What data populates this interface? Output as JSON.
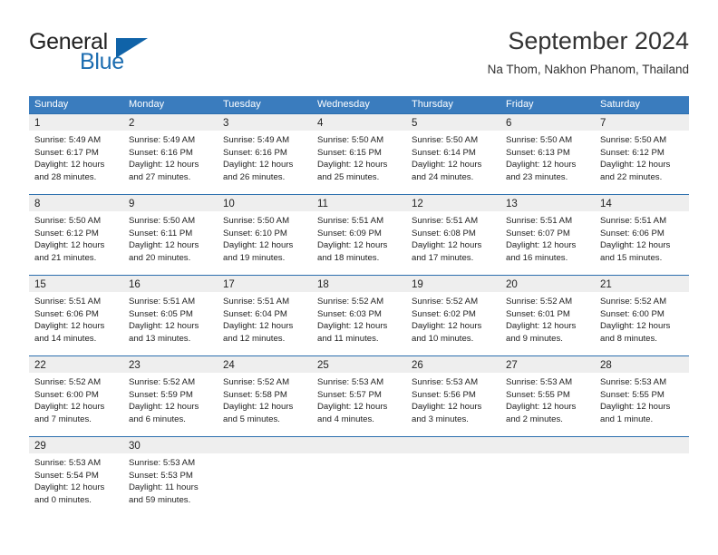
{
  "brand": {
    "name_part1": "General",
    "name_part2": "Blue",
    "triangle_color": "#1063a8",
    "blue_text_color": "#1b6cb0"
  },
  "header": {
    "title": "September 2024",
    "subtitle": "Na Thom, Nakhon Phanom, Thailand"
  },
  "theme": {
    "header_blue": "#3a7cbe",
    "row_border_blue": "#2c6fae",
    "day_band_gray": "#eeeeee"
  },
  "weekdays": [
    "Sunday",
    "Monday",
    "Tuesday",
    "Wednesday",
    "Thursday",
    "Friday",
    "Saturday"
  ],
  "weeks": [
    [
      {
        "day": "1",
        "sunrise": "Sunrise: 5:49 AM",
        "sunset": "Sunset: 6:17 PM",
        "daylight1": "Daylight: 12 hours",
        "daylight2": "and 28 minutes."
      },
      {
        "day": "2",
        "sunrise": "Sunrise: 5:49 AM",
        "sunset": "Sunset: 6:16 PM",
        "daylight1": "Daylight: 12 hours",
        "daylight2": "and 27 minutes."
      },
      {
        "day": "3",
        "sunrise": "Sunrise: 5:49 AM",
        "sunset": "Sunset: 6:16 PM",
        "daylight1": "Daylight: 12 hours",
        "daylight2": "and 26 minutes."
      },
      {
        "day": "4",
        "sunrise": "Sunrise: 5:50 AM",
        "sunset": "Sunset: 6:15 PM",
        "daylight1": "Daylight: 12 hours",
        "daylight2": "and 25 minutes."
      },
      {
        "day": "5",
        "sunrise": "Sunrise: 5:50 AM",
        "sunset": "Sunset: 6:14 PM",
        "daylight1": "Daylight: 12 hours",
        "daylight2": "and 24 minutes."
      },
      {
        "day": "6",
        "sunrise": "Sunrise: 5:50 AM",
        "sunset": "Sunset: 6:13 PM",
        "daylight1": "Daylight: 12 hours",
        "daylight2": "and 23 minutes."
      },
      {
        "day": "7",
        "sunrise": "Sunrise: 5:50 AM",
        "sunset": "Sunset: 6:12 PM",
        "daylight1": "Daylight: 12 hours",
        "daylight2": "and 22 minutes."
      }
    ],
    [
      {
        "day": "8",
        "sunrise": "Sunrise: 5:50 AM",
        "sunset": "Sunset: 6:12 PM",
        "daylight1": "Daylight: 12 hours",
        "daylight2": "and 21 minutes."
      },
      {
        "day": "9",
        "sunrise": "Sunrise: 5:50 AM",
        "sunset": "Sunset: 6:11 PM",
        "daylight1": "Daylight: 12 hours",
        "daylight2": "and 20 minutes."
      },
      {
        "day": "10",
        "sunrise": "Sunrise: 5:50 AM",
        "sunset": "Sunset: 6:10 PM",
        "daylight1": "Daylight: 12 hours",
        "daylight2": "and 19 minutes."
      },
      {
        "day": "11",
        "sunrise": "Sunrise: 5:51 AM",
        "sunset": "Sunset: 6:09 PM",
        "daylight1": "Daylight: 12 hours",
        "daylight2": "and 18 minutes."
      },
      {
        "day": "12",
        "sunrise": "Sunrise: 5:51 AM",
        "sunset": "Sunset: 6:08 PM",
        "daylight1": "Daylight: 12 hours",
        "daylight2": "and 17 minutes."
      },
      {
        "day": "13",
        "sunrise": "Sunrise: 5:51 AM",
        "sunset": "Sunset: 6:07 PM",
        "daylight1": "Daylight: 12 hours",
        "daylight2": "and 16 minutes."
      },
      {
        "day": "14",
        "sunrise": "Sunrise: 5:51 AM",
        "sunset": "Sunset: 6:06 PM",
        "daylight1": "Daylight: 12 hours",
        "daylight2": "and 15 minutes."
      }
    ],
    [
      {
        "day": "15",
        "sunrise": "Sunrise: 5:51 AM",
        "sunset": "Sunset: 6:06 PM",
        "daylight1": "Daylight: 12 hours",
        "daylight2": "and 14 minutes."
      },
      {
        "day": "16",
        "sunrise": "Sunrise: 5:51 AM",
        "sunset": "Sunset: 6:05 PM",
        "daylight1": "Daylight: 12 hours",
        "daylight2": "and 13 minutes."
      },
      {
        "day": "17",
        "sunrise": "Sunrise: 5:51 AM",
        "sunset": "Sunset: 6:04 PM",
        "daylight1": "Daylight: 12 hours",
        "daylight2": "and 12 minutes."
      },
      {
        "day": "18",
        "sunrise": "Sunrise: 5:52 AM",
        "sunset": "Sunset: 6:03 PM",
        "daylight1": "Daylight: 12 hours",
        "daylight2": "and 11 minutes."
      },
      {
        "day": "19",
        "sunrise": "Sunrise: 5:52 AM",
        "sunset": "Sunset: 6:02 PM",
        "daylight1": "Daylight: 12 hours",
        "daylight2": "and 10 minutes."
      },
      {
        "day": "20",
        "sunrise": "Sunrise: 5:52 AM",
        "sunset": "Sunset: 6:01 PM",
        "daylight1": "Daylight: 12 hours",
        "daylight2": "and 9 minutes."
      },
      {
        "day": "21",
        "sunrise": "Sunrise: 5:52 AM",
        "sunset": "Sunset: 6:00 PM",
        "daylight1": "Daylight: 12 hours",
        "daylight2": "and 8 minutes."
      }
    ],
    [
      {
        "day": "22",
        "sunrise": "Sunrise: 5:52 AM",
        "sunset": "Sunset: 6:00 PM",
        "daylight1": "Daylight: 12 hours",
        "daylight2": "and 7 minutes."
      },
      {
        "day": "23",
        "sunrise": "Sunrise: 5:52 AM",
        "sunset": "Sunset: 5:59 PM",
        "daylight1": "Daylight: 12 hours",
        "daylight2": "and 6 minutes."
      },
      {
        "day": "24",
        "sunrise": "Sunrise: 5:52 AM",
        "sunset": "Sunset: 5:58 PM",
        "daylight1": "Daylight: 12 hours",
        "daylight2": "and 5 minutes."
      },
      {
        "day": "25",
        "sunrise": "Sunrise: 5:53 AM",
        "sunset": "Sunset: 5:57 PM",
        "daylight1": "Daylight: 12 hours",
        "daylight2": "and 4 minutes."
      },
      {
        "day": "26",
        "sunrise": "Sunrise: 5:53 AM",
        "sunset": "Sunset: 5:56 PM",
        "daylight1": "Daylight: 12 hours",
        "daylight2": "and 3 minutes."
      },
      {
        "day": "27",
        "sunrise": "Sunrise: 5:53 AM",
        "sunset": "Sunset: 5:55 PM",
        "daylight1": "Daylight: 12 hours",
        "daylight2": "and 2 minutes."
      },
      {
        "day": "28",
        "sunrise": "Sunrise: 5:53 AM",
        "sunset": "Sunset: 5:55 PM",
        "daylight1": "Daylight: 12 hours",
        "daylight2": "and 1 minute."
      }
    ],
    [
      {
        "day": "29",
        "sunrise": "Sunrise: 5:53 AM",
        "sunset": "Sunset: 5:54 PM",
        "daylight1": "Daylight: 12 hours",
        "daylight2": "and 0 minutes."
      },
      {
        "day": "30",
        "sunrise": "Sunrise: 5:53 AM",
        "sunset": "Sunset: 5:53 PM",
        "daylight1": "Daylight: 11 hours",
        "daylight2": "and 59 minutes."
      },
      {
        "day": "",
        "sunrise": "",
        "sunset": "",
        "daylight1": "",
        "daylight2": ""
      },
      {
        "day": "",
        "sunrise": "",
        "sunset": "",
        "daylight1": "",
        "daylight2": ""
      },
      {
        "day": "",
        "sunrise": "",
        "sunset": "",
        "daylight1": "",
        "daylight2": ""
      },
      {
        "day": "",
        "sunrise": "",
        "sunset": "",
        "daylight1": "",
        "daylight2": ""
      },
      {
        "day": "",
        "sunrise": "",
        "sunset": "",
        "daylight1": "",
        "daylight2": ""
      }
    ]
  ]
}
